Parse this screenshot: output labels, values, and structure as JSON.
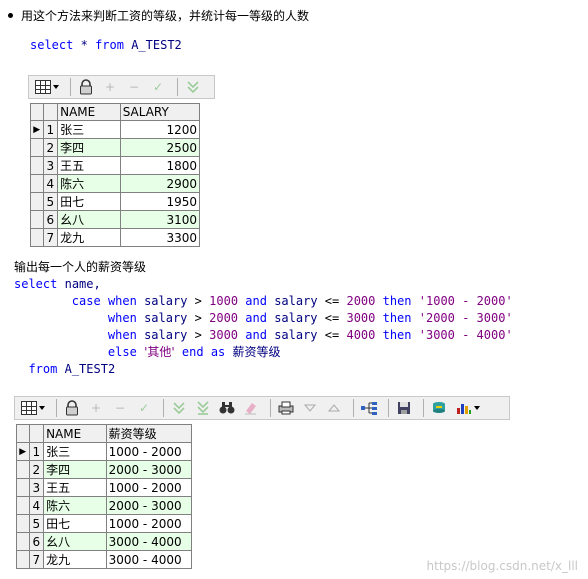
{
  "intro": "用这个方法来判断工资的等级，并统计每一等级的人数",
  "query1": {
    "select": "select",
    "star": "*",
    "from": "from",
    "table": "A_TEST2"
  },
  "table1": {
    "headers": [
      "NAME",
      "SALARY"
    ],
    "rows": [
      {
        "n": "1",
        "name": "张三",
        "salary": "1200"
      },
      {
        "n": "2",
        "name": "李四",
        "salary": "2500"
      },
      {
        "n": "3",
        "name": "王五",
        "salary": "1800"
      },
      {
        "n": "4",
        "name": "陈六",
        "salary": "2900"
      },
      {
        "n": "5",
        "name": "田七",
        "salary": "1950"
      },
      {
        "n": "6",
        "name": "幺八",
        "salary": "3100"
      },
      {
        "n": "7",
        "name": "龙九",
        "salary": "3300"
      }
    ]
  },
  "caption2": "输出每一个人的薪资等级",
  "query2": {
    "l1_select": "select",
    "l1_name": "name,",
    "case": "case",
    "when": "when",
    "salary": "salary",
    "and": "and",
    "then": "then",
    "else": "else",
    "end": "end",
    "as": "as",
    "gt": ">",
    "le": "<=",
    "w1_a": "1000",
    "w1_b": "2000",
    "w1_s": "'1000 - 2000'",
    "w2_a": "2000",
    "w2_b": "3000",
    "w2_s": "'2000 - 3000'",
    "w3_a": "3000",
    "w3_b": "4000",
    "w3_s": "'3000 - 4000'",
    "else_val": "'其他'",
    "alias": "薪资等级",
    "from": "from",
    "table": "A_TEST2"
  },
  "table2": {
    "headers": [
      "NAME",
      "薪资等级"
    ],
    "rows": [
      {
        "n": "1",
        "name": "张三",
        "grade": "1000 - 2000"
      },
      {
        "n": "2",
        "name": "李四",
        "grade": "2000 - 3000"
      },
      {
        "n": "3",
        "name": "王五",
        "grade": "1000 - 2000"
      },
      {
        "n": "4",
        "name": "陈六",
        "grade": "2000 - 3000"
      },
      {
        "n": "5",
        "name": "田七",
        "grade": "1000 - 2000"
      },
      {
        "n": "6",
        "name": "幺八",
        "grade": "3000 - 4000"
      },
      {
        "n": "7",
        "name": "龙九",
        "grade": "3000 - 4000"
      }
    ]
  },
  "icons": {
    "plus": "+",
    "minus": "−",
    "check": "✓"
  },
  "watermark": "https://blog.csdn.net/x_lll"
}
